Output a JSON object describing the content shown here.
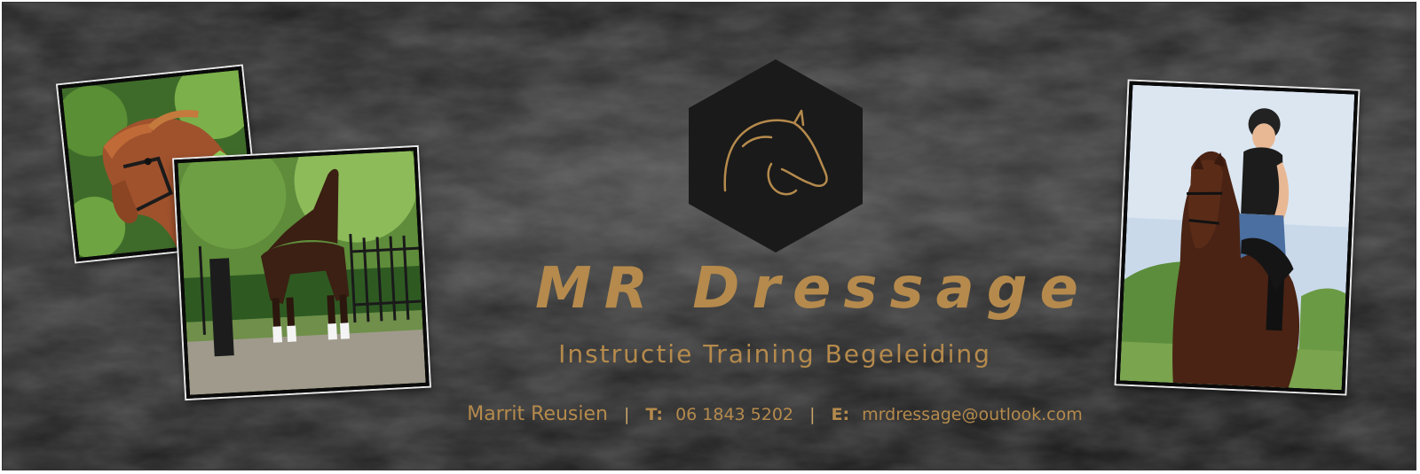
{
  "brand": {
    "title": "MR Dressage",
    "tagline": "Instructie Training Begeleiding"
  },
  "contact": {
    "name": "Marrit Reusien",
    "separator": "|",
    "phone_label": "T:",
    "phone": "06 1843 5202",
    "email_label": "E:",
    "email": "mrdressage@outlook.com"
  },
  "colors": {
    "gold": "#b58a4c",
    "background": "#1f1f1f",
    "logo_hexagon": "#1a1a1a"
  },
  "icons": {
    "logo": "horse-head-icon"
  }
}
